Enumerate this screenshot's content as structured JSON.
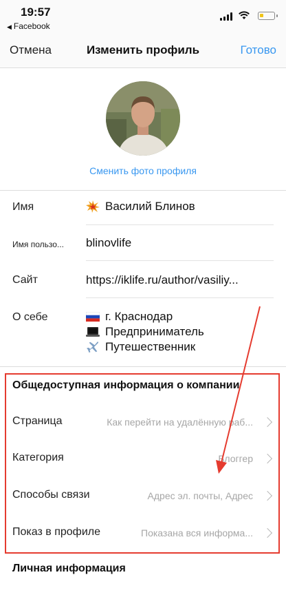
{
  "status_bar": {
    "time": "19:57",
    "back_app": "Facebook"
  },
  "nav": {
    "cancel": "Отмена",
    "title": "Изменить профиль",
    "done": "Готово"
  },
  "profile": {
    "change_photo": "Сменить фото профиля"
  },
  "fields": {
    "name": {
      "label": "Имя",
      "value": "Василий Блинов"
    },
    "username": {
      "label": "Имя пользо...",
      "value": "blinovlife"
    },
    "website": {
      "label": "Сайт",
      "value": "https://iklife.ru/author/vasiliy..."
    },
    "bio": {
      "label": "О себе",
      "lines": [
        "г. Краснодар",
        "Предприниматель",
        "Путешественник"
      ]
    }
  },
  "business": {
    "title": "Общедоступная информация о компании",
    "rows": [
      {
        "label": "Страница",
        "value": "Как перейти на удалённую раб..."
      },
      {
        "label": "Категория",
        "value": "Блоггер"
      },
      {
        "label": "Способы связи",
        "value": "Адрес эл. почты, Адрес"
      },
      {
        "label": "Показ в профиле",
        "value": "Показана вся информа..."
      }
    ]
  },
  "personal": {
    "title": "Личная информация"
  },
  "colors": {
    "accent": "#3897f0",
    "highlight_box": "#e53b2f",
    "annotation_arrow": "#e53b2f"
  },
  "icons": [
    "explosion-emoji-icon",
    "russia-flag-icon",
    "laptop-icon",
    "airplane-icon",
    "chevron-right-icon",
    "signal-icon",
    "wifi-icon",
    "battery-icon"
  ]
}
